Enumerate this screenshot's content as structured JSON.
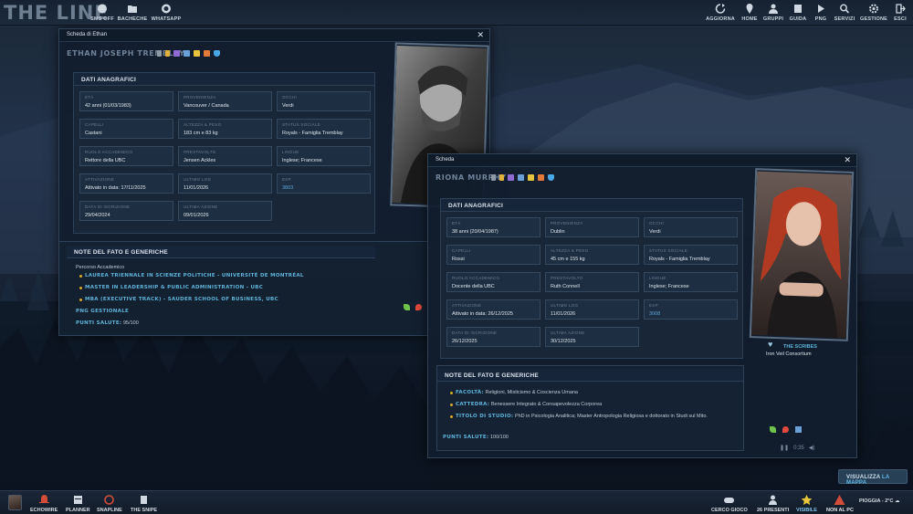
{
  "app": {
    "title": "THE LINE"
  },
  "topbar": {
    "left": [
      {
        "label": "SMS OFF",
        "icon": "sms-icon"
      },
      {
        "label": "BACHECHE",
        "icon": "folder-icon"
      },
      {
        "label": "WHATSAPP",
        "icon": "whatsapp-icon"
      }
    ],
    "right": [
      {
        "label": "AGGIORNA",
        "icon": "refresh-icon"
      },
      {
        "label": "HOME",
        "icon": "location-icon"
      },
      {
        "label": "GRUPPI",
        "icon": "group-icon"
      },
      {
        "label": "GUIDA",
        "icon": "book-icon"
      },
      {
        "label": "PNG",
        "icon": "play-icon"
      },
      {
        "label": "SERVIZI",
        "icon": "search-icon"
      },
      {
        "label": "GESTIONE",
        "icon": "gear-icon"
      },
      {
        "label": "ESCI",
        "icon": "exit-icon"
      }
    ]
  },
  "win1": {
    "title": "Scheda di Ethan",
    "name": "ETHAN JOSEPH TREMBLAY",
    "section_title": "DATI ANAGRAFICI",
    "fields": [
      {
        "k": "ETÀ",
        "v": "42 anni (01/03/1983)"
      },
      {
        "k": "PROVENIENZA",
        "v": "Vancouver / Canada"
      },
      {
        "k": "OCCHI",
        "v": "Verdi"
      },
      {
        "k": "CAPELLI",
        "v": "Castani"
      },
      {
        "k": "ALTEZZA & PESO",
        "v": "183 cm e 83 kg"
      },
      {
        "k": "STATUS SOCIALE",
        "v": "Royals - Famiglia Tremblay"
      },
      {
        "k": "RUOLO ACCADEMICO",
        "v": "Rettore della UBC"
      },
      {
        "k": "PRESTAVOLTO",
        "v": "Jensen Ackles"
      },
      {
        "k": "LINGUE",
        "v": "Inglese; Francese"
      },
      {
        "k": "ATTIVAZIONE",
        "v": "Attivato in data: 17/11/2025"
      },
      {
        "k": "ULTIMO LOG",
        "v": "11/01/2026"
      },
      {
        "k": "EXP",
        "v": "3803"
      },
      {
        "k": "DATA DI ISCRIZIONE",
        "v": "29/04/2024"
      },
      {
        "k": "ULTIMA AZIONE",
        "v": "09/01/2026"
      }
    ],
    "notes_title": "NOTE DEL FATO E GENERICHE",
    "notes_intro": "Percorso Accademico",
    "notes": [
      "LAUREA TRIENNALE IN SCIENZE POLITICHE - UNIVERSITÉ DE MONTRÉAL",
      "MASTER IN LEADERSHIP & PUBLIC ADMINISTRATION - UBC",
      "MBA (EXECUTIVE TRACK) - SAUDER SCHOOL OF BUSINESS, UBC"
    ],
    "png_label": "PNG GESTIONALE",
    "hp_label": "PUNTI SALUTE:",
    "hp_value": "95/100"
  },
  "win2": {
    "title": "Scheda",
    "name": "RIONA MURPHY",
    "section_title": "DATI ANAGRAFICI",
    "fields": [
      {
        "k": "ETÀ",
        "v": "38 anni (20/04/1987)"
      },
      {
        "k": "PROVENIENZA",
        "v": "Dublin"
      },
      {
        "k": "OCCHI",
        "v": "Verdi"
      },
      {
        "k": "CAPELLI",
        "v": "Rossi"
      },
      {
        "k": "ALTEZZA & PESO",
        "v": "45 cm e 155 kg"
      },
      {
        "k": "STATUS SOCIALE",
        "v": "Royals - Famiglia Tremblay"
      },
      {
        "k": "RUOLO ACCADEMICO",
        "v": "Docente della UBC"
      },
      {
        "k": "PRESTAVOLTO",
        "v": "Ruth Connell"
      },
      {
        "k": "LINGUE",
        "v": "Inglese; Francese"
      },
      {
        "k": "ATTIVAZIONE",
        "v": "Attivato in data: 26/12/2025"
      },
      {
        "k": "ULTIMO LOG",
        "v": "11/01/2026"
      },
      {
        "k": "EXP",
        "v": "3008"
      },
      {
        "k": "DATA DI ISCRIZIONE",
        "v": "26/12/2025"
      },
      {
        "k": "ULTIMA AZIONE",
        "v": "30/12/2025"
      }
    ],
    "notes_title": "NOTE DEL FATO E GENERICHE",
    "notes": [
      {
        "k": "FACOLTÀ:",
        "v": "Religioni, Misticismo & Coscienza Umana"
      },
      {
        "k": "CATTEDRA:",
        "v": "Benessere Integrato & Consapevolezza Corporea"
      },
      {
        "k": "TITOLO DI STUDIO:",
        "v": "PhD in Psicologia Analitica; Master Antropologia Religiosa e dottorato in Studi sul Mito."
      }
    ],
    "hp_label": "PUNTI SALUTE:",
    "hp_value": "100/100",
    "group_name": "THE SCRIBES",
    "group_sub": "Iron Veil Consortium",
    "player_time": "0:35"
  },
  "map_button": {
    "a": "VISUALIZZA ",
    "b": "LA MAPPA"
  },
  "botbar": {
    "left": [
      {
        "label": "ECHOWIRE",
        "icon": "bell-icon"
      },
      {
        "label": "PLANNER",
        "icon": "planner-icon"
      },
      {
        "label": "SNAPLINE",
        "icon": "snap-icon"
      },
      {
        "label": "THE SNIPE",
        "icon": "snipe-icon"
      }
    ],
    "right": [
      {
        "label": "CERCO GIOCO",
        "icon": "gamepad-icon"
      },
      {
        "label": "26 PRESENTI",
        "icon": "users-icon"
      },
      {
        "label": "VISIBILE",
        "icon": "star-icon"
      },
      {
        "label": "NON AL PC",
        "icon": "warning-icon"
      }
    ],
    "weather": "PIOGGIA - 2°C"
  },
  "colors": {
    "accent": "#5fb2d8",
    "gold": "#d9a92a",
    "panel": "#1d2d42"
  }
}
